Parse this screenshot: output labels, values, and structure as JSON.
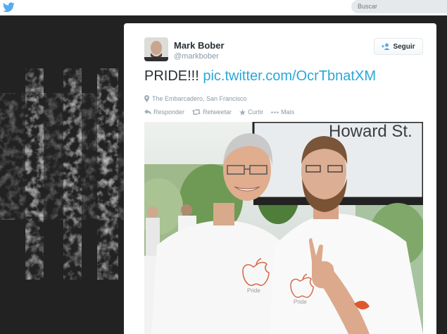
{
  "header": {
    "search_placeholder": "Buscar",
    "logo_icon": "twitter-bird-icon",
    "accent_color": "#55acee"
  },
  "tweet": {
    "fullname": "Mark Bober",
    "screenname": "@markbober",
    "follow_label": "Seguir",
    "text": "PRIDE!!!",
    "link_text": "pic.twitter.com/OcrTbnatXM",
    "link_color": "#2aa8d4",
    "place": "The Embarcadero, San Francisco",
    "actions": {
      "reply": "Responder",
      "retweet": "Retweetar",
      "favorite": "Curtir",
      "more": "Mais"
    }
  },
  "photo": {
    "sign_text": "Howard St.",
    "shirt_text": "Pride"
  }
}
